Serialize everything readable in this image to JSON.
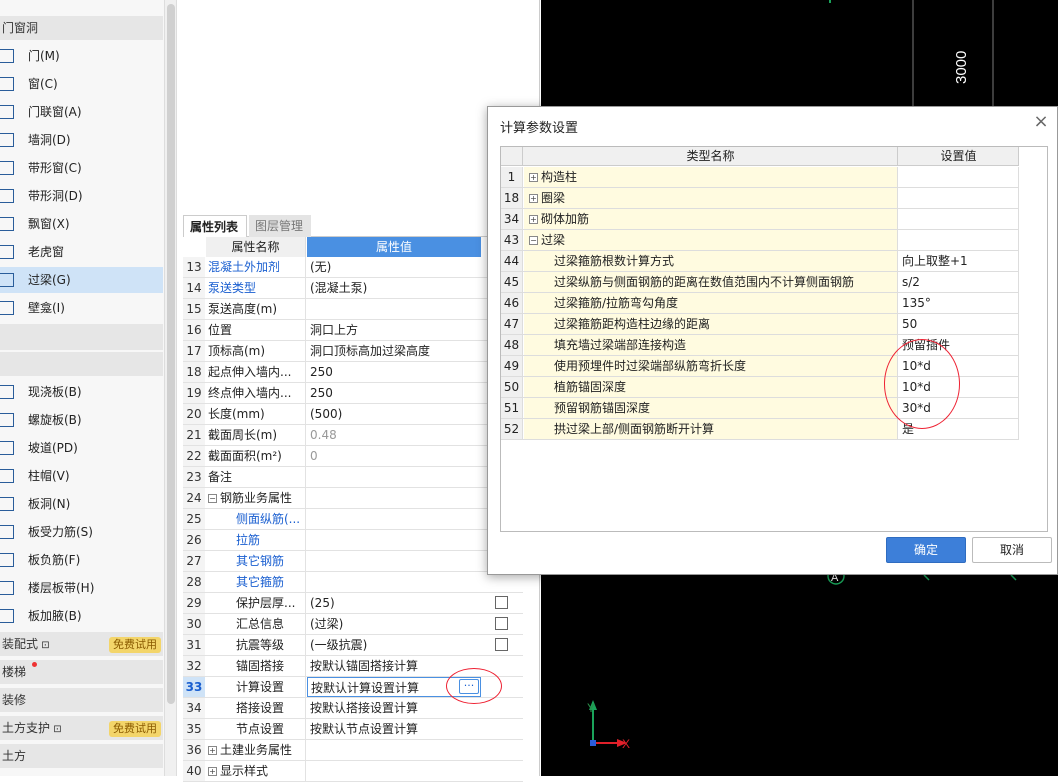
{
  "left_toolbar": {
    "section_top": "门窗洞",
    "items_a": [
      {
        "label": "门(M)"
      },
      {
        "label": "窗(C)"
      },
      {
        "label": "门联窗(A)"
      },
      {
        "label": "墙洞(D)"
      },
      {
        "label": "带形窗(C)"
      },
      {
        "label": "带形洞(D)"
      },
      {
        "label": "飘窗(X)"
      },
      {
        "label": "老虎窗"
      },
      {
        "label": "过梁(G)"
      },
      {
        "label": "壁龛(I)"
      }
    ],
    "items_b": [
      {
        "label": "现浇板(B)"
      },
      {
        "label": "螺旋板(B)"
      },
      {
        "label": "坡道(PD)"
      },
      {
        "label": "柱帽(V)"
      },
      {
        "label": "板洞(N)"
      },
      {
        "label": "板受力筋(S)"
      },
      {
        "label": "板负筋(F)"
      },
      {
        "label": "楼层板带(H)"
      },
      {
        "label": "板加腋(B)"
      }
    ],
    "sec_assembly": "装配式",
    "sec_stairs": "楼梯",
    "sec_decor": "装修",
    "sec_support": "土方支护",
    "sec_earth": "土方",
    "badge": "免费试用"
  },
  "props": {
    "tab_active": "属性列表",
    "tab_inactive": "图层管理",
    "col_name": "属性名称",
    "col_value": "属性值",
    "rows": [
      {
        "num": "13",
        "name": "混凝土外加剂",
        "value": "(无)"
      },
      {
        "num": "14",
        "name": "泵送类型",
        "value": "(混凝土泵)"
      },
      {
        "num": "15",
        "name": "泵送高度(m)",
        "value": ""
      },
      {
        "num": "16",
        "name": "位置",
        "value": "洞口上方"
      },
      {
        "num": "17",
        "name": "顶标高(m)",
        "value": "洞口顶标高加过梁高度"
      },
      {
        "num": "18",
        "name": "起点伸入墙内...",
        "value": "250"
      },
      {
        "num": "19",
        "name": "终点伸入墙内...",
        "value": "250"
      },
      {
        "num": "20",
        "name": "长度(mm)",
        "value": "(500)"
      },
      {
        "num": "21",
        "name": "截面周长(m)",
        "value": "0.48"
      },
      {
        "num": "22",
        "name": "截面面积(m²)",
        "value": "0"
      },
      {
        "num": "23",
        "name": "备注",
        "value": ""
      },
      {
        "num": "24",
        "name": "钢筋业务属性",
        "value": ""
      },
      {
        "num": "25",
        "name": "侧面纵筋(...",
        "value": ""
      },
      {
        "num": "26",
        "name": "拉筋",
        "value": ""
      },
      {
        "num": "27",
        "name": "其它钢筋",
        "value": ""
      },
      {
        "num": "28",
        "name": "其它箍筋",
        "value": ""
      },
      {
        "num": "29",
        "name": "保护层厚...",
        "value": "(25)"
      },
      {
        "num": "30",
        "name": "汇总信息",
        "value": "(过梁)"
      },
      {
        "num": "31",
        "name": "抗震等级",
        "value": "(一级抗震)"
      },
      {
        "num": "32",
        "name": "锚固搭接",
        "value": "按默认锚固搭接计算"
      },
      {
        "num": "33",
        "name": "计算设置",
        "value": "按默认计算设置计算"
      },
      {
        "num": "34",
        "name": "搭接设置",
        "value": "按默认搭接设置计算"
      },
      {
        "num": "35",
        "name": "节点设置",
        "value": "按默认节点设置计算"
      },
      {
        "num": "36",
        "name": "土建业务属性",
        "value": ""
      },
      {
        "num": "40",
        "name": "显示样式",
        "value": ""
      }
    ],
    "more_glyph": "···"
  },
  "canvas": {
    "dim_label": "3000",
    "axis_marker": "A",
    "x_axis": "X",
    "y_axis": "Y"
  },
  "dialog": {
    "title": "计算参数设置",
    "col_type": "类型名称",
    "col_value": "设置值",
    "rows": [
      {
        "num": "1",
        "name": "构造柱",
        "value": "",
        "group": true,
        "exp": "+"
      },
      {
        "num": "18",
        "name": "圈梁",
        "value": "",
        "group": true,
        "exp": "+"
      },
      {
        "num": "34",
        "name": "砌体加筋",
        "value": "",
        "group": true,
        "exp": "+"
      },
      {
        "num": "43",
        "name": "过梁",
        "value": "",
        "group": true,
        "exp": "−"
      },
      {
        "num": "44",
        "name": "过梁箍筋根数计算方式",
        "value": "向上取整+1"
      },
      {
        "num": "45",
        "name": "过梁纵筋与侧面钢筋的距离在数值范围内不计算侧面钢筋",
        "value": "s/2"
      },
      {
        "num": "46",
        "name": "过梁箍筋/拉筋弯勾角度",
        "value": "135°"
      },
      {
        "num": "47",
        "name": "过梁箍筋距构造柱边缘的距离",
        "value": "50"
      },
      {
        "num": "48",
        "name": "填充墙过梁端部连接构造",
        "value": "预留插件"
      },
      {
        "num": "49",
        "name": "使用预埋件时过梁端部纵筋弯折长度",
        "value": "10*d"
      },
      {
        "num": "50",
        "name": "植筋锚固深度",
        "value": "10*d"
      },
      {
        "num": "51",
        "name": "预留钢筋锚固深度",
        "value": "30*d"
      },
      {
        "num": "52",
        "name": "拱过梁上部/侧面钢筋断开计算",
        "value": "是"
      }
    ],
    "ok_label": "确定",
    "cancel_label": "取消",
    "close_glyph": "×"
  }
}
